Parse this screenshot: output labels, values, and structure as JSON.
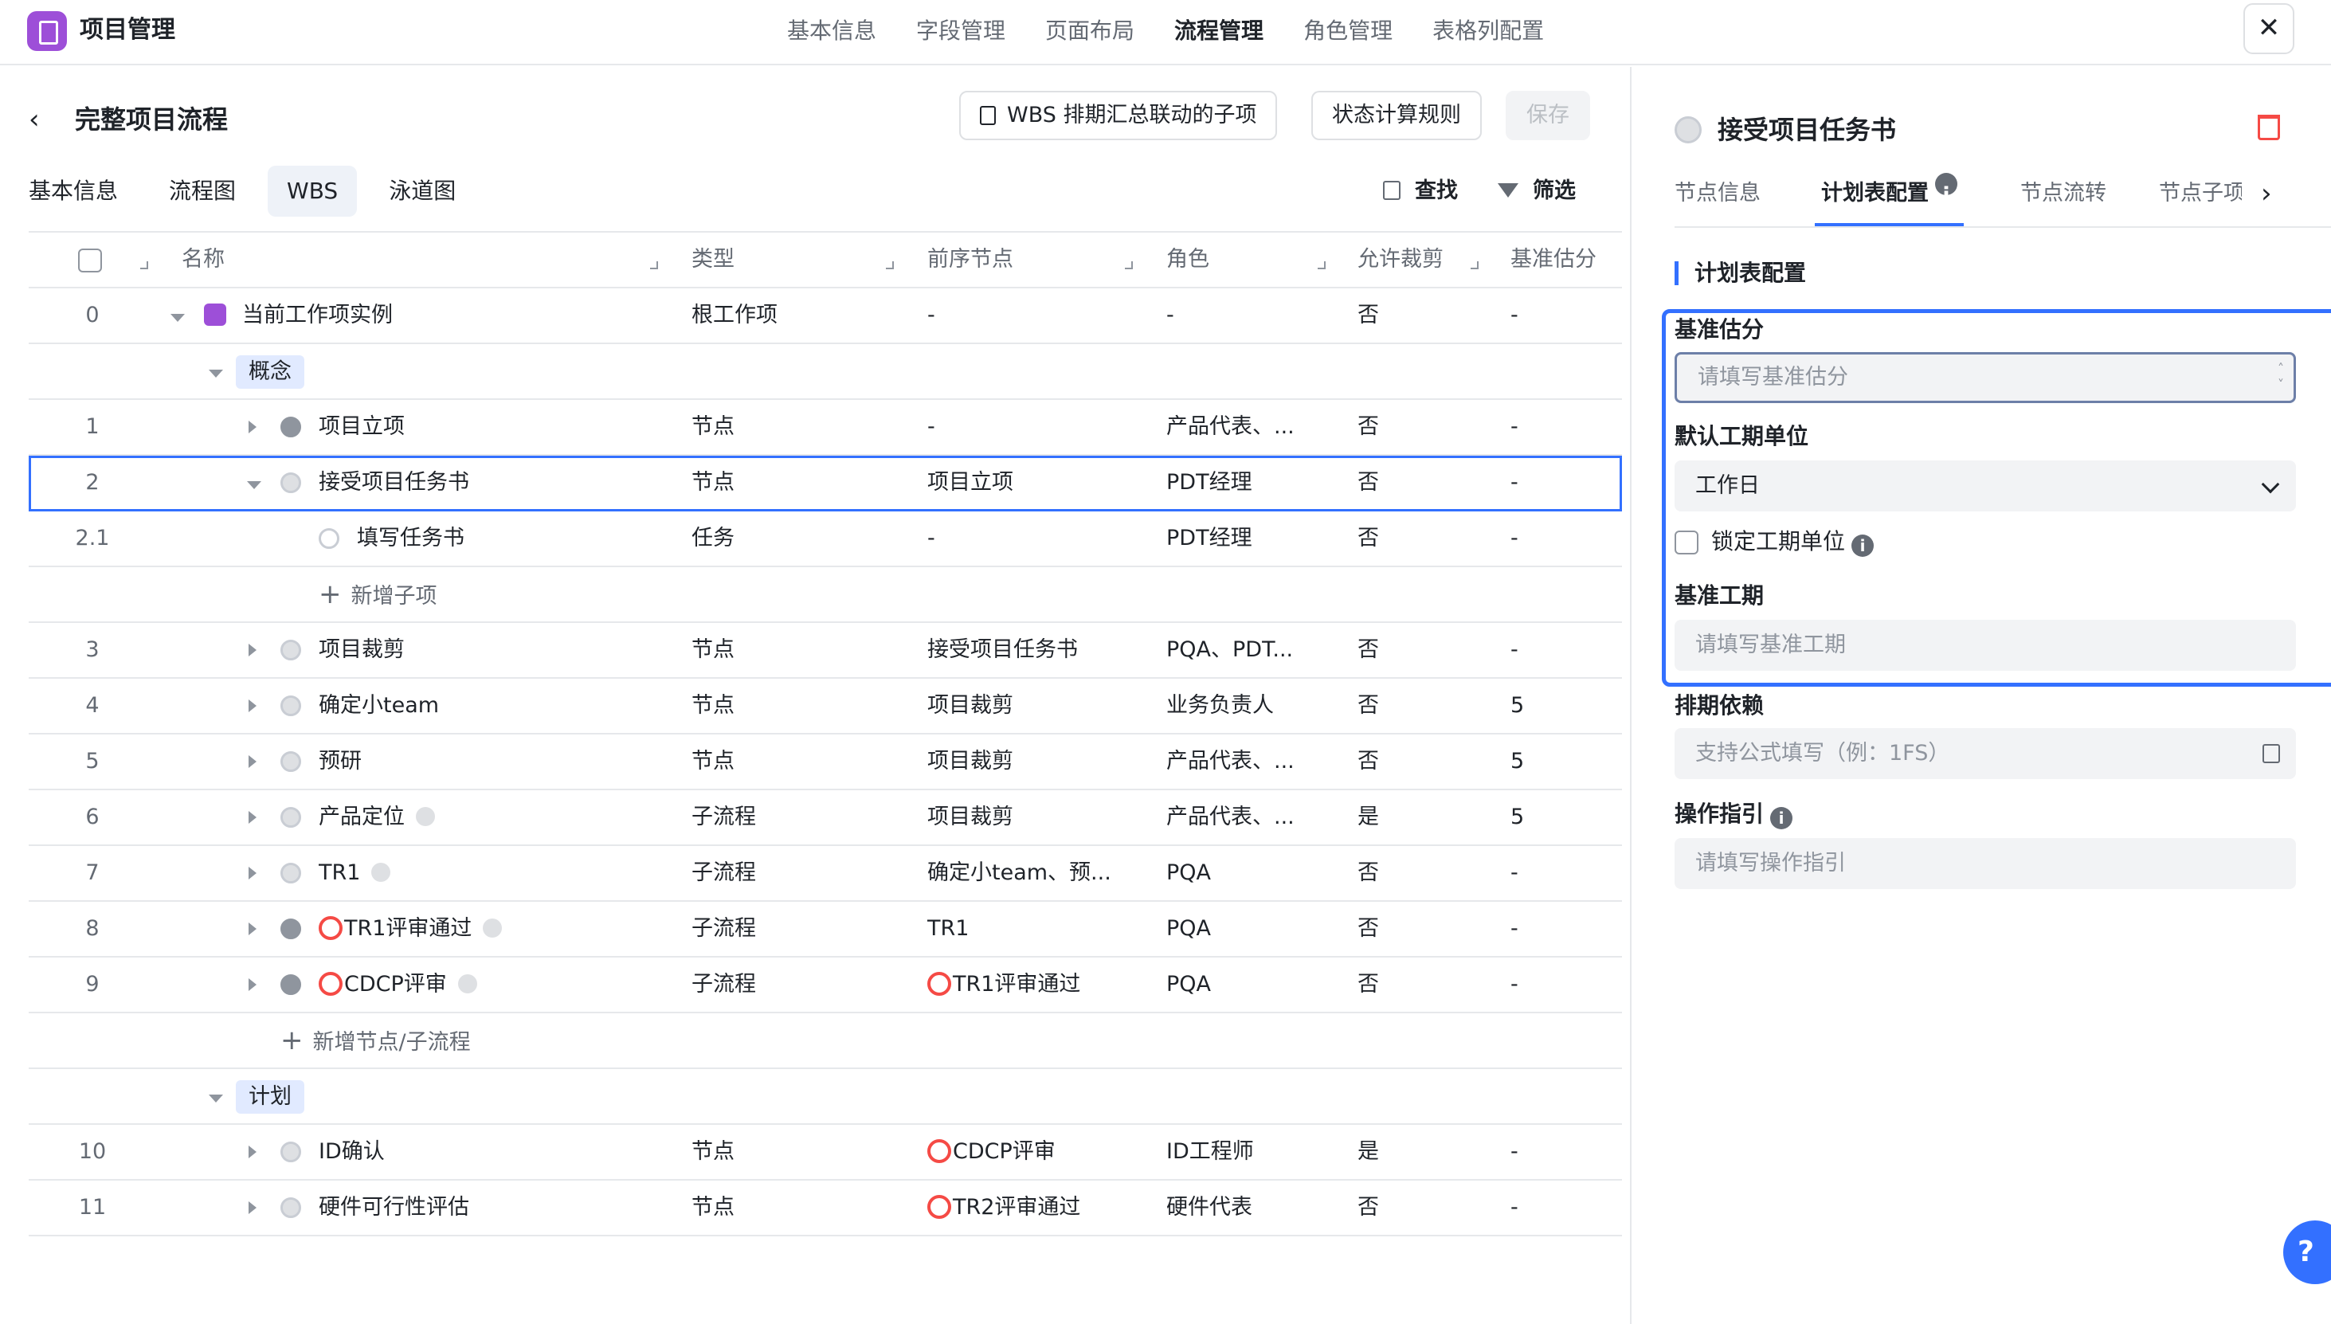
{
  "app": {
    "title": "项目管理"
  },
  "topnav": [
    "基本信息",
    "字段管理",
    "页面布局",
    "流程管理",
    "角色管理",
    "表格列配置"
  ],
  "process": {
    "title": "完整项目流程"
  },
  "toolbar": {
    "wbs_btn": "WBS 排期汇总联动的子项",
    "rule_btn": "状态计算规则",
    "save_btn": "保存",
    "find": "查找",
    "filter": "筛选"
  },
  "subtabs": [
    "基本信息",
    "流程图",
    "WBS",
    "泳道图"
  ],
  "table": {
    "headers": {
      "name": "名称",
      "type": "类型",
      "pred": "前序节点",
      "role": "角色",
      "cut": "允许裁剪",
      "est": "基准估分"
    },
    "rows": [
      {
        "idx": "0",
        "name": "当前工作项实例",
        "type": "根工作项",
        "pred": "-",
        "role": "-",
        "cut": "否",
        "est": "-"
      },
      {
        "group": "概念"
      },
      {
        "idx": "1",
        "name": "项目立项",
        "type": "节点",
        "pred": "-",
        "role": "产品代表、...",
        "cut": "否",
        "est": "-"
      },
      {
        "idx": "2",
        "name": "接受项目任务书",
        "type": "节点",
        "pred": "项目立项",
        "role": "PDT经理",
        "cut": "否",
        "est": "-"
      },
      {
        "idx": "2.1",
        "name": "填写任务书",
        "type": "任务",
        "pred": "-",
        "role": "PDT经理",
        "cut": "否",
        "est": "-"
      },
      {
        "add": "新增子项"
      },
      {
        "idx": "3",
        "name": "项目裁剪",
        "type": "节点",
        "pred": "接受项目任务书",
        "role": "PQA、PDT...",
        "cut": "否",
        "est": "-"
      },
      {
        "idx": "4",
        "name": "确定小team",
        "type": "节点",
        "pred": "项目裁剪",
        "role": "业务负责人",
        "cut": "否",
        "est": "5"
      },
      {
        "idx": "5",
        "name": "预研",
        "type": "节点",
        "pred": "项目裁剪",
        "role": "产品代表、...",
        "cut": "否",
        "est": "5"
      },
      {
        "idx": "6",
        "name": "产品定位",
        "type": "子流程",
        "pred": "项目裁剪",
        "role": "产品代表、...",
        "cut": "是",
        "est": "5"
      },
      {
        "idx": "7",
        "name": "TR1",
        "type": "子流程",
        "pred": "确定小team、预...",
        "role": "PQA",
        "cut": "否",
        "est": "-"
      },
      {
        "idx": "8",
        "name": "TR1评审通过",
        "type": "子流程",
        "pred": "TR1",
        "role": "PQA",
        "cut": "否",
        "est": "-"
      },
      {
        "idx": "9",
        "name": "CDCP评审",
        "type": "子流程",
        "pred": "TR1评审通过",
        "role": "PQA",
        "cut": "否",
        "est": "-"
      },
      {
        "add": "新增节点/子流程"
      },
      {
        "group": "计划"
      },
      {
        "idx": "10",
        "name": "ID确认",
        "type": "节点",
        "pred": "CDCP评审",
        "role": "ID工程师",
        "cut": "是",
        "est": "-"
      },
      {
        "idx": "11",
        "name": "硬件可行性评估",
        "type": "节点",
        "pred": "TR2评审通过",
        "role": "硬件代表",
        "cut": "否",
        "est": "-"
      }
    ]
  },
  "panel": {
    "title": "接受项目任务书",
    "tabs": [
      "节点信息",
      "计划表配置",
      "节点流转",
      "节点子项"
    ],
    "section": "计划表配置",
    "est_label": "基准估分",
    "est_placeholder": "请填写基准估分",
    "unit_label": "默认工期单位",
    "unit_value": "工作日",
    "lock_label": "锁定工期单位",
    "dur_label": "基准工期",
    "dur_placeholder": "请填写基准工期",
    "dep_label": "排期依赖",
    "dep_placeholder": "支持公式填写（例：1FS）",
    "guide_label": "操作指引",
    "guide_placeholder": "请填写操作指引"
  },
  "colors": {
    "accent": "#3370ff",
    "brand": "#9d4fd8",
    "danger": "#f54a45"
  }
}
